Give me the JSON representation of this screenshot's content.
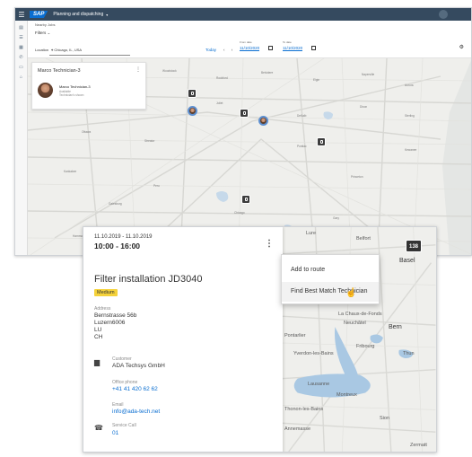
{
  "window1": {
    "shell": {
      "logo": "SAP",
      "title": "Planning and dispatching",
      "caret": "▾"
    },
    "filters": {
      "caption": "Nearby Jobs",
      "filter_label": "Filters ⌄",
      "location_label": "Location",
      "location_value": "⌖ Chicago, IL, USA",
      "today": "Today",
      "nav_arrows": "‹ ›",
      "from_label": "From date",
      "from_date": "11/10/2020",
      "to_label": "To date",
      "to_date": "11/10/2020"
    },
    "technician_card": {
      "title": "Marco Technician-3",
      "name": "Marco Technician-3",
      "status": "Available",
      "hours": "Technician's shown"
    },
    "map_labels": [
      "Woodstock",
      "Rockford",
      "Belvidere",
      "Elgin",
      "Naperville",
      "Aurora",
      "Joliet",
      "DeKalb",
      "Dixon",
      "Sterling",
      "Ottawa",
      "Streator",
      "Pontiac",
      "Kankakee",
      "Peru",
      "Princeton",
      "Kewanee",
      "Galesburg",
      "Chicago",
      "Gary",
      "Hammond",
      "Waukegan",
      "Valparaiso",
      "Michigan City"
    ]
  },
  "window2": {
    "order": {
      "date": "11.10.2019 - 11.10.2019",
      "time": "10:00 - 16:00",
      "title": "Filter installation JD3040",
      "priority": "Medium",
      "address_label": "Address",
      "address_lines": [
        "Bernstrasse 56b",
        "Luzern6006",
        "LU",
        "CH"
      ],
      "customer_label": "Customer",
      "customer_value": "ADA Techsys GmbH",
      "phone_label": "Office phone",
      "phone_value": "+41 41 420 62 62",
      "email_label": "Email",
      "email_value": "info@ada-tech.net",
      "service_label": "Service Call",
      "service_value": "01"
    },
    "menu": {
      "add_to_route": "Add to route",
      "find_best_match": "Find Best Match Technician"
    },
    "badge": "138",
    "map_labels": {
      "lure": "Lure",
      "belfort": "Belfort",
      "basel": "Basel",
      "chaux": "La Chaux-de-Fonds",
      "neuchatel": "Neuchâtel",
      "bern": "Bern",
      "pontarlier": "Pontarlier",
      "fribourg": "Fribourg",
      "thun": "Thun",
      "yverdon": "Yverdon-les-Bains",
      "lausanne": "Lausanne",
      "montreux": "Montreux",
      "thonon": "Thonon-les-Bains",
      "sion": "Sion",
      "annemasse": "Annemasse",
      "zermatt": "Zermatt"
    }
  }
}
